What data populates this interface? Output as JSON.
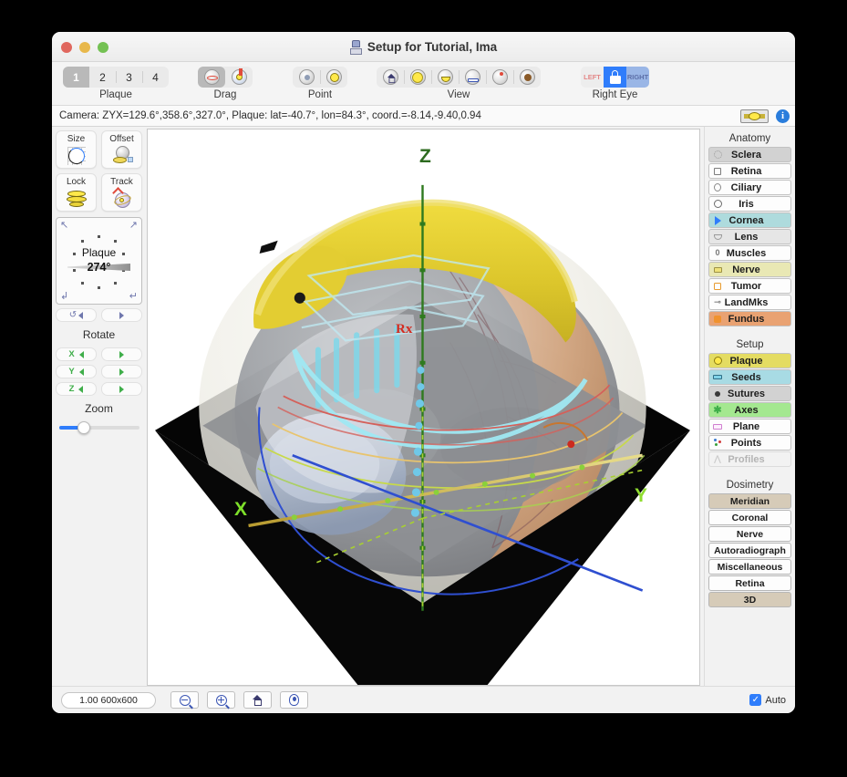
{
  "window": {
    "title": "Setup for Tutorial, Ima",
    "title_icon": "plaque-app-icon",
    "traffic_lights": [
      "close-button",
      "minimize-button",
      "zoom-button"
    ]
  },
  "toolbar": {
    "groups": [
      {
        "name": "plaque",
        "label": "Plaque",
        "items": [
          "1",
          "2",
          "3",
          "4"
        ],
        "selected_index": 0
      },
      {
        "name": "drag",
        "label": "Drag",
        "items": [
          "drag-rotate-icon",
          "drag-plaque-icon"
        ],
        "selected_index": 0
      },
      {
        "name": "point",
        "label": "Point",
        "items": [
          "point-marker-icon",
          "point-plaque-icon"
        ],
        "selected_index": -1
      },
      {
        "name": "view",
        "label": "View",
        "items": [
          "view-home-icon",
          "view-light-icon",
          "view-plaque-icon",
          "view-plane-icon",
          "view-target-icon",
          "view-fundus-icon"
        ],
        "selected_index": -1
      },
      {
        "name": "eye",
        "label": "Right Eye",
        "items": [
          "LEFT",
          "lock-icon",
          "RIGHT"
        ],
        "selected_index": 2
      }
    ]
  },
  "statusbar": {
    "text": "Camera: ZYX=129.6°,358.6°,327.0°, Plaque: lat=-40.7°, lon=84.3°, coord.=-8.14,-9.40,0.94",
    "plaque_button_icon": "plaque-icon",
    "info_button_icon": "info-icon"
  },
  "left_panel": {
    "tiles": [
      {
        "label": "Size",
        "icon": "plaque-size-icon"
      },
      {
        "label": "Offset",
        "icon": "plaque-offset-icon"
      },
      {
        "label": "Lock",
        "icon": "plaque-lock-icon"
      },
      {
        "label": "Track",
        "icon": "plaque-track-icon"
      }
    ],
    "dial": {
      "title": "Plaque",
      "value": "274°",
      "corner_icons": [
        "arrow-up-left-icon",
        "arrow-up-right-icon",
        "arrow-down-left-icon",
        "arrow-return-icon"
      ]
    },
    "cycle_row": {
      "left_icon": "cycle-icon",
      "right_icon": "play-icon"
    },
    "rotate": {
      "label": "Rotate",
      "axes": [
        "X",
        "Y",
        "Z"
      ]
    },
    "zoom": {
      "label": "Zoom",
      "value_pct": 25
    }
  },
  "viewport": {
    "axis_labels": {
      "z": "Z",
      "x": "X",
      "y": "Y"
    },
    "rx_label": "Rx"
  },
  "right_panel": {
    "anatomy": {
      "title": "Anatomy",
      "items": [
        {
          "label": "Sclera",
          "icon": "sclera-icon",
          "bg": "#d2d2d2",
          "active": true
        },
        {
          "label": "Retina",
          "icon": "retina-icon",
          "bg": "#fdfdfd",
          "active": false
        },
        {
          "label": "Ciliary",
          "icon": "ciliary-icon",
          "bg": "#fdfdfd",
          "active": false
        },
        {
          "label": "Iris",
          "icon": "iris-icon",
          "bg": "#fdfdfd",
          "active": false
        },
        {
          "label": "Cornea",
          "icon": "cornea-icon",
          "bg": "#aedbdd",
          "active": true
        },
        {
          "label": "Lens",
          "icon": "lens-icon",
          "bg": "#e6e6e6",
          "active": true
        },
        {
          "label": "Muscles",
          "icon": "muscles-icon",
          "bg": "#fdfdfd",
          "active": false
        },
        {
          "label": "Nerve",
          "icon": "nerve-icon",
          "bg": "#e9e8b4",
          "active": true
        },
        {
          "label": "Tumor",
          "icon": "tumor-icon",
          "bg": "#fdfdfd",
          "active": false
        },
        {
          "label": "LandMks",
          "icon": "landmarks-icon",
          "bg": "#fdfdfd",
          "active": false
        },
        {
          "label": "Fundus",
          "icon": "fundus-icon",
          "bg": "#e9a272",
          "active": true
        }
      ]
    },
    "setup": {
      "title": "Setup",
      "items": [
        {
          "label": "Plaque",
          "icon": "plaque-icon",
          "bg": "#e4dc62",
          "active": true,
          "disabled": false
        },
        {
          "label": "Seeds",
          "icon": "seeds-icon",
          "bg": "#a8dbe4",
          "active": true,
          "disabled": false
        },
        {
          "label": "Sutures",
          "icon": "sutures-icon",
          "bg": "#d2d2d2",
          "active": true,
          "disabled": false
        },
        {
          "label": "Axes",
          "icon": "axes-icon",
          "bg": "#a4e890",
          "active": true,
          "disabled": false
        },
        {
          "label": "Plane",
          "icon": "plane-icon",
          "bg": "#fdfdfd",
          "active": false,
          "disabled": false
        },
        {
          "label": "Points",
          "icon": "points-icon",
          "bg": "#fdfdfd",
          "active": false,
          "disabled": false
        },
        {
          "label": "Profiles",
          "icon": "profiles-icon",
          "bg": "#f2f2f2",
          "active": false,
          "disabled": true
        }
      ]
    },
    "dosimetry": {
      "title": "Dosimetry",
      "items": [
        {
          "label": "Meridian",
          "bg": "#d6cbb8",
          "active": true
        },
        {
          "label": "Coronal",
          "bg": "#fdfdfd",
          "active": false
        },
        {
          "label": "Nerve",
          "bg": "#fdfdfd",
          "active": false
        },
        {
          "label": "Autoradiograph",
          "bg": "#fdfdfd",
          "active": false
        },
        {
          "label": "Miscellaneous",
          "bg": "#fdfdfd",
          "active": false
        },
        {
          "label": "Retina",
          "bg": "#fdfdfd",
          "active": false
        },
        {
          "label": "3D",
          "bg": "#d6cbb8",
          "active": true
        }
      ]
    }
  },
  "bottom_bar": {
    "scale_field": "1.00 600x600",
    "buttons": [
      "zoom-out-icon",
      "zoom-in-icon",
      "home-icon",
      "eye-icon"
    ],
    "auto_label": "Auto",
    "auto_checked": true,
    "check_glyph": "✓"
  }
}
